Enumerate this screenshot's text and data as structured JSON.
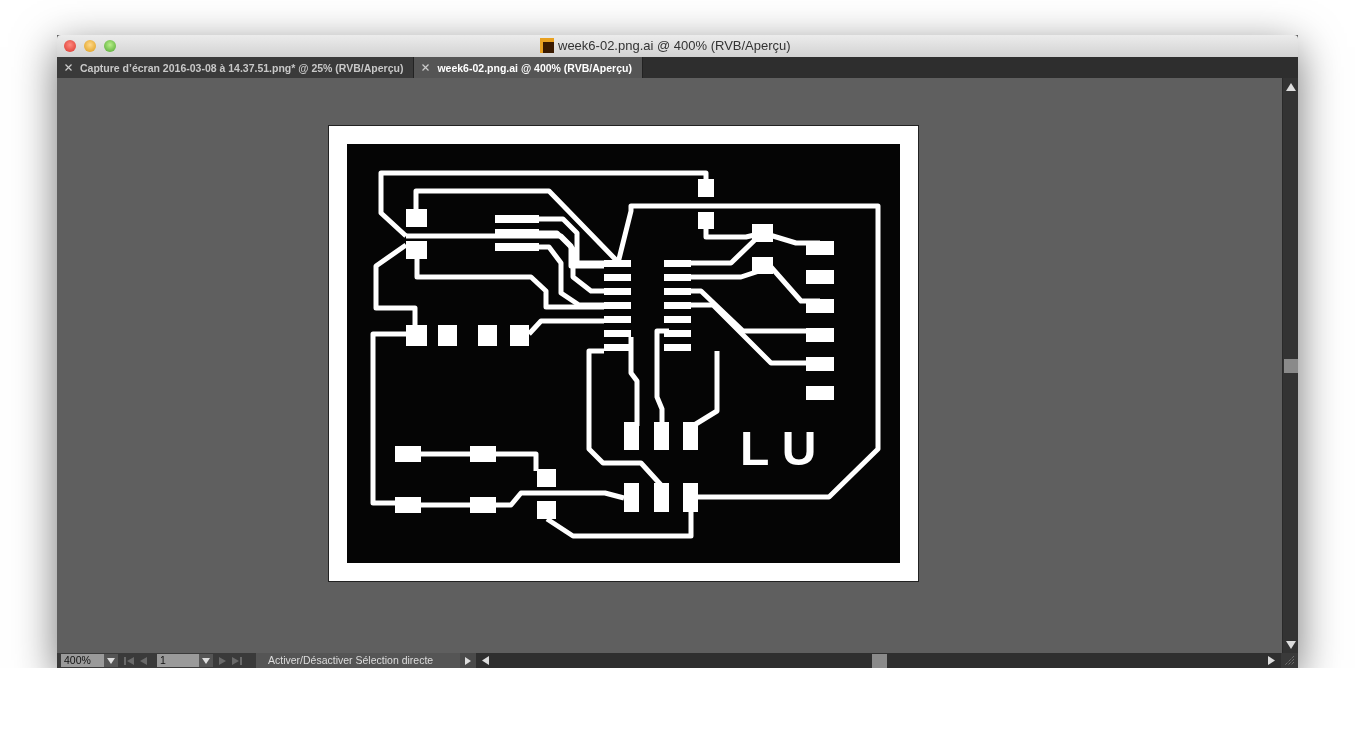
{
  "window": {
    "title": "week6-02.png.ai @ 400% (RVB/Aperçu)"
  },
  "tabs": [
    {
      "label": "Capture d’écran 2016-03-08 à 14.37.51.png* @ 25% (RVB/Aperçu)",
      "selected": false
    },
    {
      "label": "week6-02.png.ai @ 400% (RVB/Aperçu)",
      "selected": true
    }
  ],
  "artwork": {
    "board_label": "L U"
  },
  "status_bar": {
    "zoom": "400%",
    "page": "1",
    "message": "Activer/Désactiver Sélection directe"
  }
}
